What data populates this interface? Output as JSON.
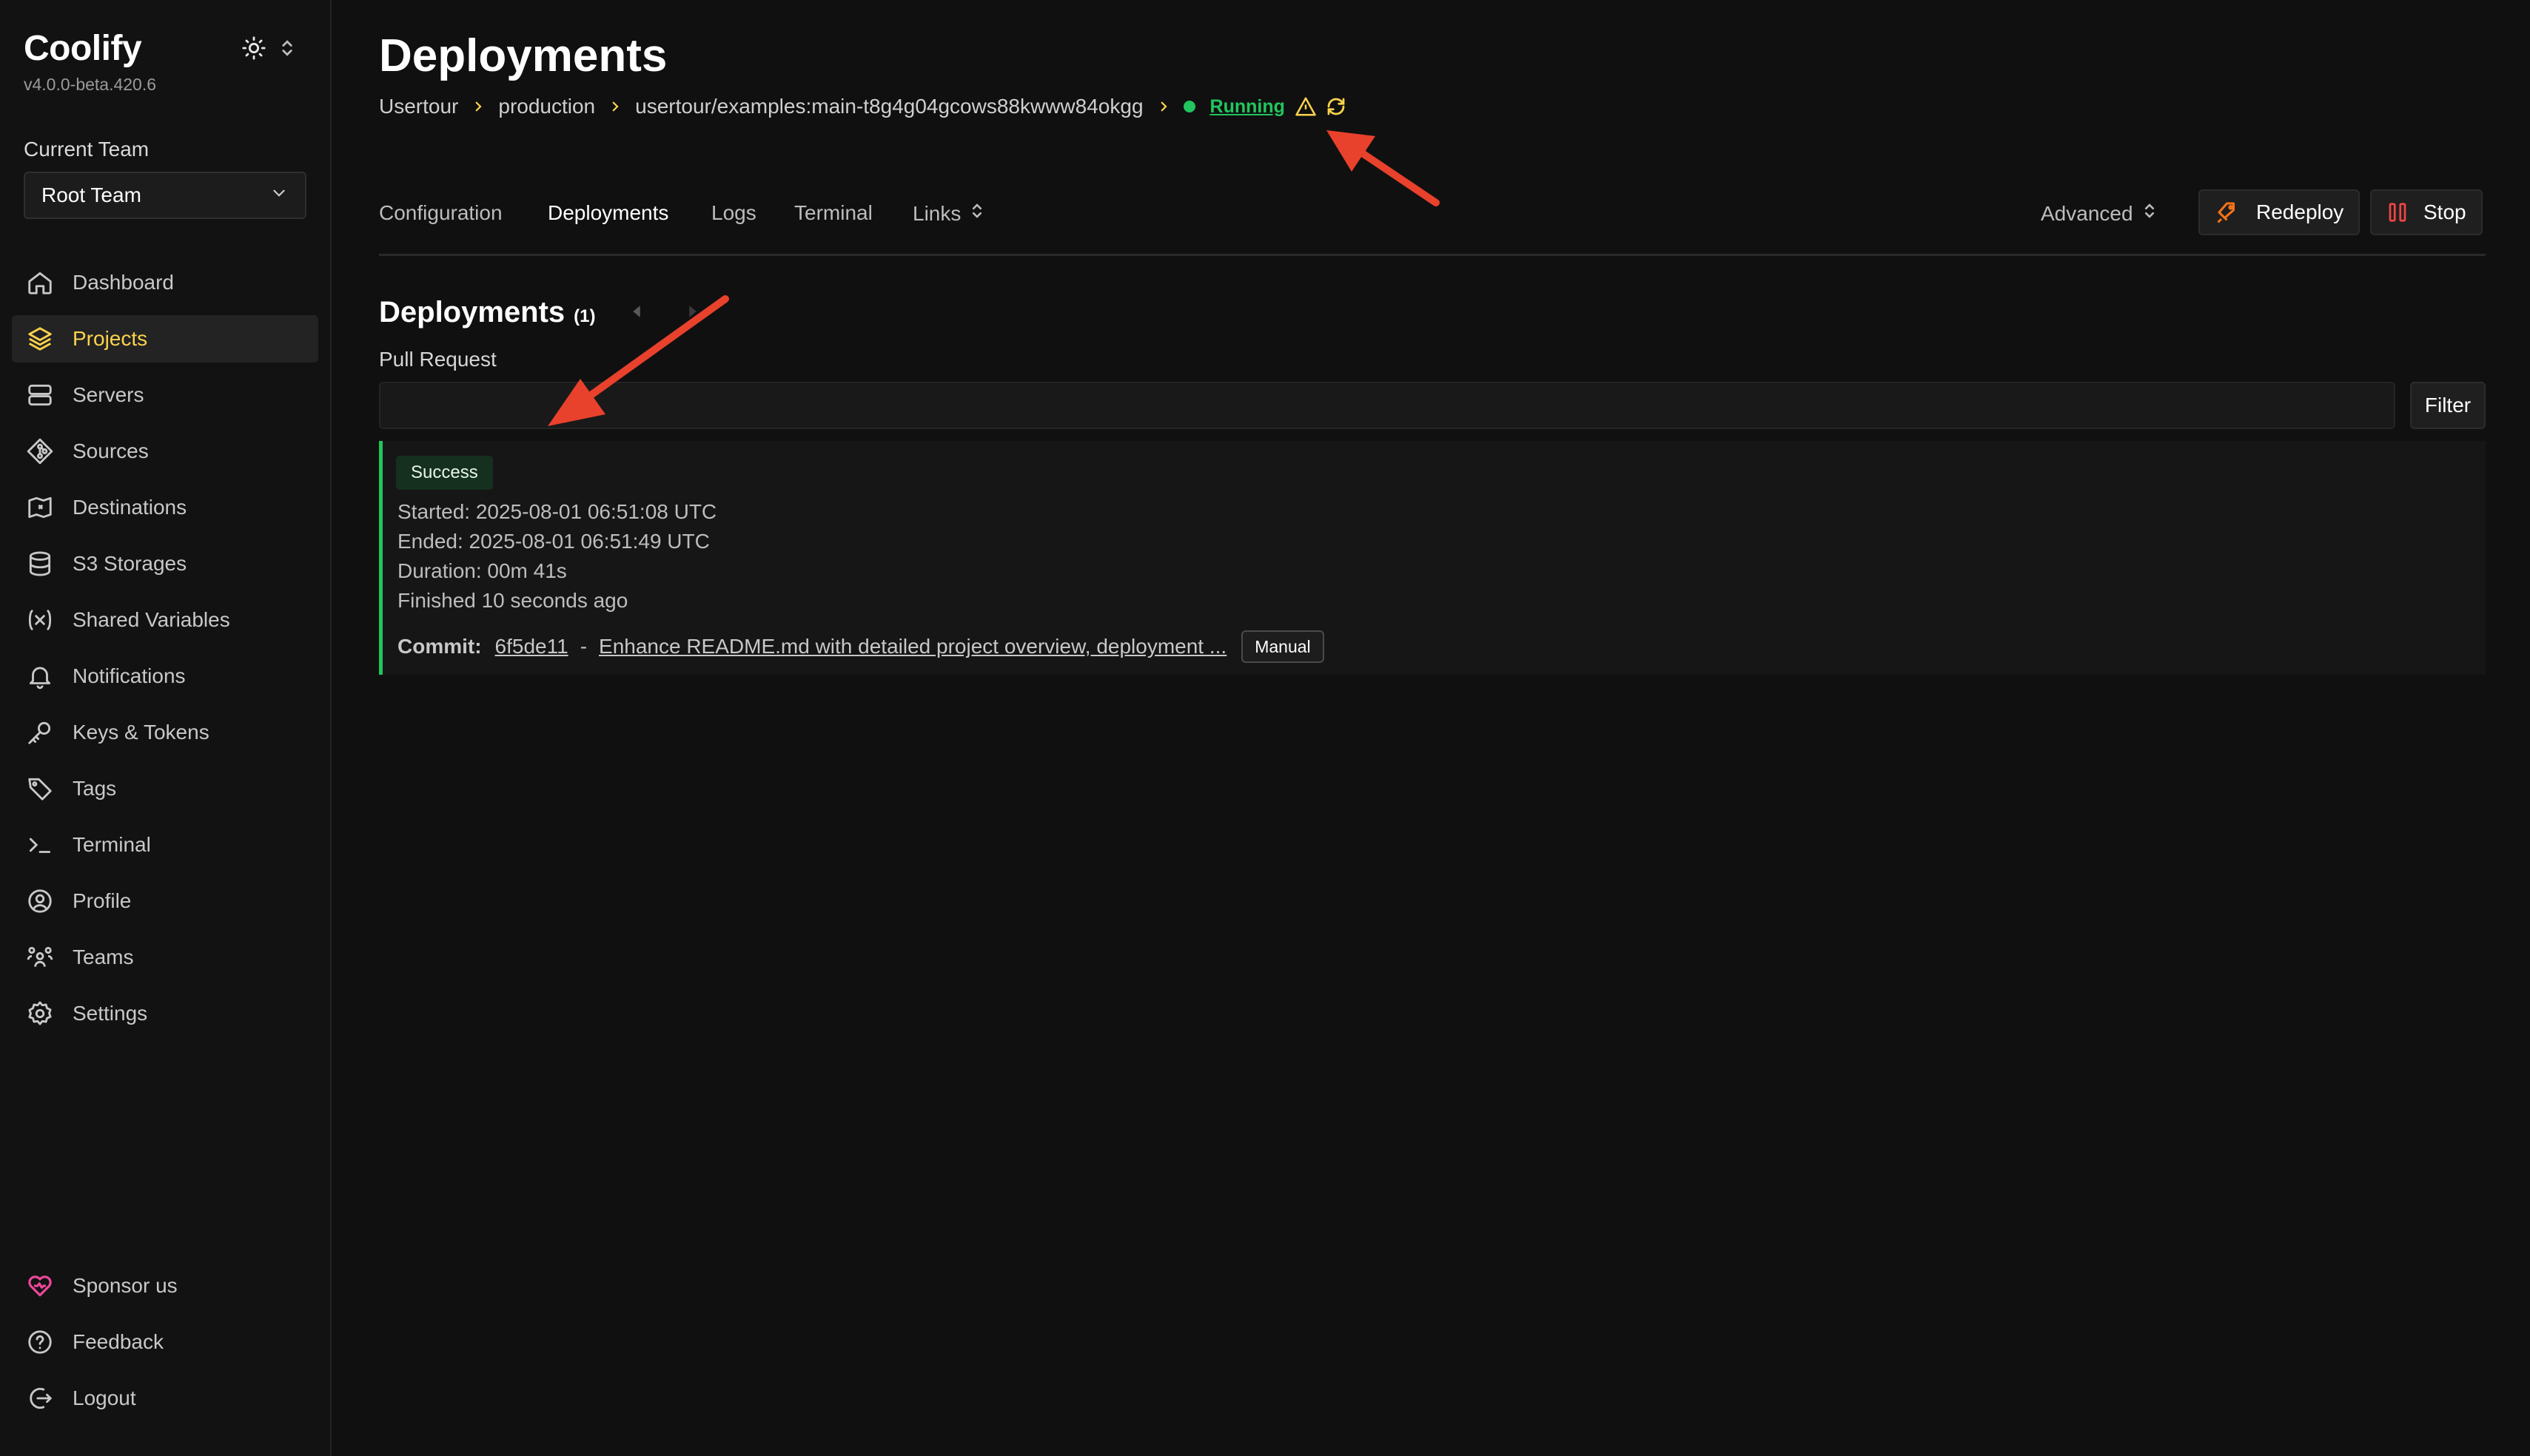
{
  "app": {
    "name": "Coolify",
    "version": "v4.0.0-beta.420.6"
  },
  "team": {
    "label": "Current Team",
    "selected": "Root Team"
  },
  "sidebar": {
    "items": [
      {
        "label": "Dashboard",
        "icon": "home-icon"
      },
      {
        "label": "Projects",
        "icon": "layers-icon",
        "active": true
      },
      {
        "label": "Servers",
        "icon": "server-icon"
      },
      {
        "label": "Sources",
        "icon": "git-icon"
      },
      {
        "label": "Destinations",
        "icon": "map-icon"
      },
      {
        "label": "S3 Storages",
        "icon": "database-icon"
      },
      {
        "label": "Shared Variables",
        "icon": "variable-icon"
      },
      {
        "label": "Notifications",
        "icon": "bell-icon"
      },
      {
        "label": "Keys & Tokens",
        "icon": "key-icon"
      },
      {
        "label": "Tags",
        "icon": "tag-icon"
      },
      {
        "label": "Terminal",
        "icon": "terminal-icon"
      },
      {
        "label": "Profile",
        "icon": "user-circle-icon"
      },
      {
        "label": "Teams",
        "icon": "users-icon"
      },
      {
        "label": "Settings",
        "icon": "gear-icon"
      }
    ],
    "bottom": [
      {
        "label": "Sponsor us",
        "icon": "heart-icon"
      },
      {
        "label": "Feedback",
        "icon": "help-circle-icon"
      },
      {
        "label": "Logout",
        "icon": "logout-icon"
      }
    ]
  },
  "page": {
    "title": "Deployments",
    "breadcrumb": [
      "Usertour",
      "production",
      "usertour/examples:main-t8g4g04gcows88kwww84okgg"
    ],
    "status": "Running"
  },
  "tabs": [
    "Configuration",
    "Deployments",
    "Logs",
    "Terminal",
    "Links"
  ],
  "actions": {
    "advanced": "Advanced",
    "redeploy": "Redeploy",
    "stop": "Stop"
  },
  "deployments": {
    "title": "Deployments",
    "count": "(1)",
    "filter_label": "Pull Request",
    "filter_button": "Filter",
    "items": [
      {
        "status": "Success",
        "started": "Started: 2025-08-01 06:51:08 UTC",
        "ended": "Ended: 2025-08-01 06:51:49 UTC",
        "duration": "Duration: 00m 41s",
        "finished": "Finished 10 seconds ago",
        "commit_label": "Commit:",
        "commit_hash": "6f5de11",
        "commit_sep": "-",
        "commit_message": "Enhance README.md with detailed project overview, deployment ...",
        "trigger": "Manual"
      }
    ]
  },
  "colors": {
    "accent": "#fcd34d",
    "success": "#22c55e",
    "danger": "#ef4444",
    "redeploy": "#f97316",
    "annotation": "#e8412c"
  }
}
